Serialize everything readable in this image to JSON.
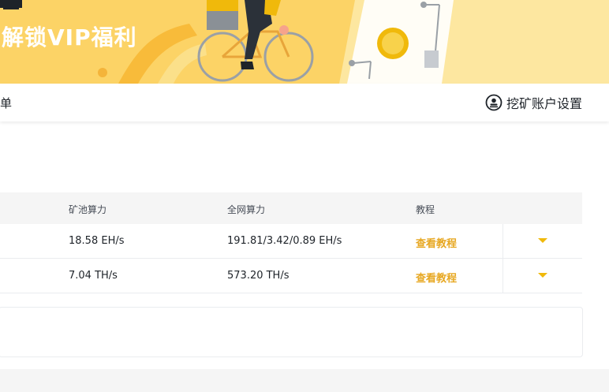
{
  "banner": {
    "title": "解锁VIP福利"
  },
  "nav": {
    "left_partial": "单",
    "account_settings_label": "挖矿账户设置"
  },
  "table": {
    "headers": {
      "pool_hashrate": "矿池算力",
      "network_hashrate": "全网算力",
      "tutorial": "教程"
    },
    "rows": [
      {
        "pool_hashrate": "18.58 EH/s",
        "network_hashrate": "191.81/3.42/0.89 EH/s",
        "tutorial": "查看教程"
      },
      {
        "pool_hashrate": "7.04 TH/s",
        "network_hashrate": "573.20 TH/s",
        "tutorial": "查看教程"
      }
    ]
  },
  "colors": {
    "banner_bg": "#fcd366",
    "accent": "#f0b90b",
    "link": "#e7a823"
  }
}
